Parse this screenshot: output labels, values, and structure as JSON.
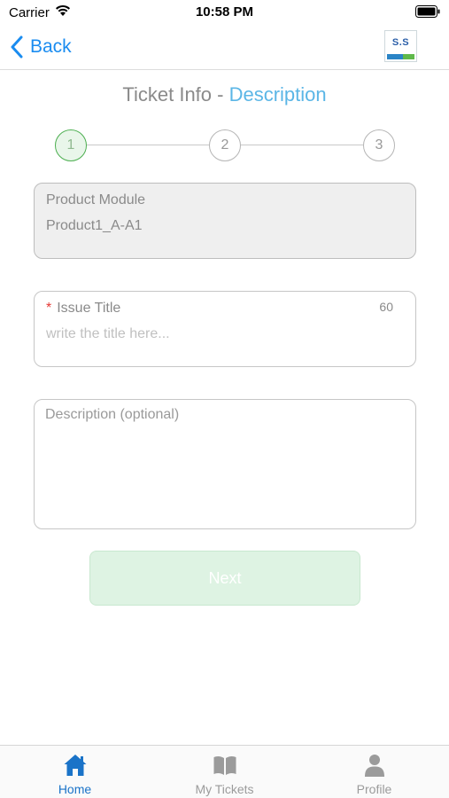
{
  "status_bar": {
    "carrier": "Carrier",
    "time": "10:58 PM"
  },
  "nav": {
    "back_label": "Back",
    "logo_text": "S.S"
  },
  "heading": {
    "prefix": "Ticket Info - ",
    "accent": "Description"
  },
  "stepper": {
    "steps": [
      "1",
      "2",
      "3"
    ],
    "current": 1
  },
  "product_module": {
    "label": "Product Module",
    "value": "Product1_A-A1"
  },
  "issue_title": {
    "required_mark": "*",
    "label": "Issue Title",
    "char_limit": "60",
    "value": "",
    "placeholder": "write the title here..."
  },
  "description": {
    "placeholder": "Description (optional)",
    "value": ""
  },
  "next_button": {
    "label": "Next"
  },
  "tab_bar": {
    "tabs": [
      {
        "label": "Home",
        "icon": "home-icon",
        "active": true
      },
      {
        "label": "My Tickets",
        "icon": "book-icon",
        "active": false
      },
      {
        "label": "Profile",
        "icon": "user-icon",
        "active": false
      }
    ]
  },
  "colors": {
    "accent_blue": "#1a8cf0",
    "heading_accent": "#5bb6e6",
    "active_step": "#4caf50",
    "required": "#e53935",
    "next_button_bg": "#def3e3",
    "tab_active": "#1a73c8"
  }
}
